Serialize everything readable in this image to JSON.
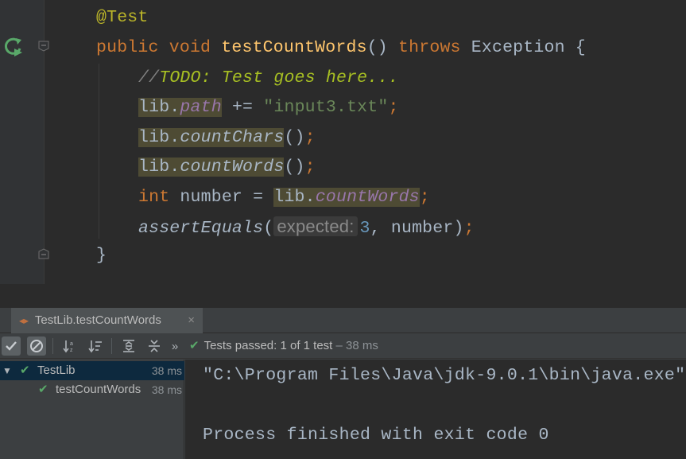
{
  "editor": {
    "lines": {
      "annotation": "@Test",
      "sig_public": "public",
      "sig_void": "void",
      "sig_name": "testCountWords",
      "sig_parens": "()",
      "sig_throws": "throws",
      "sig_exception": "Exception",
      "sig_brace": "{",
      "comment_slashes": "//",
      "comment_todo": "TODO: Test goes here...",
      "l1_obj": "lib.",
      "l1_field": "path",
      "l1_op": " += ",
      "l1_str": "\"input3.txt\"",
      "l1_semi": ";",
      "l2_obj": "lib.",
      "l2_method": "countChars",
      "l2_call": "()",
      "l2_semi": ";",
      "l3_obj": "lib.",
      "l3_method": "countWords",
      "l3_call": "()",
      "l3_semi": ";",
      "l4_int": "int",
      "l4_rest": " number = ",
      "l4_obj": "lib.",
      "l4_field": "countWords",
      "l4_semi": ";",
      "l5_method": "assertEquals",
      "l5_open": "(",
      "l5_hint": "expected:",
      "l5_num": "3",
      "l5_rest": ", number)",
      "l5_semi": ";",
      "close_brace": "}"
    }
  },
  "run_window": {
    "tab_label": "TestLib.testCountWords",
    "tab_close": "×",
    "status_label": "Tests passed:",
    "status_count": "1 of 1 test",
    "status_time": "– 38 ms",
    "overflow": "»"
  },
  "tree": {
    "items": [
      {
        "label": "TestLib",
        "time": "38 ms",
        "status": "passed"
      },
      {
        "label": "testCountWords",
        "time": "38 ms",
        "status": "passed"
      }
    ]
  },
  "console": {
    "lines": [
      "\"C:\\Program Files\\Java\\jdk-9.0.1\\bin\\java.exe\"",
      "",
      "Process finished with exit code 0"
    ]
  },
  "colors": {
    "editor_bg": "#2b2b2b",
    "keyword": "#cc7832",
    "method": "#ffc66d",
    "string": "#6a8759",
    "pass_green": "#59a869",
    "selection": "#0d293e"
  }
}
